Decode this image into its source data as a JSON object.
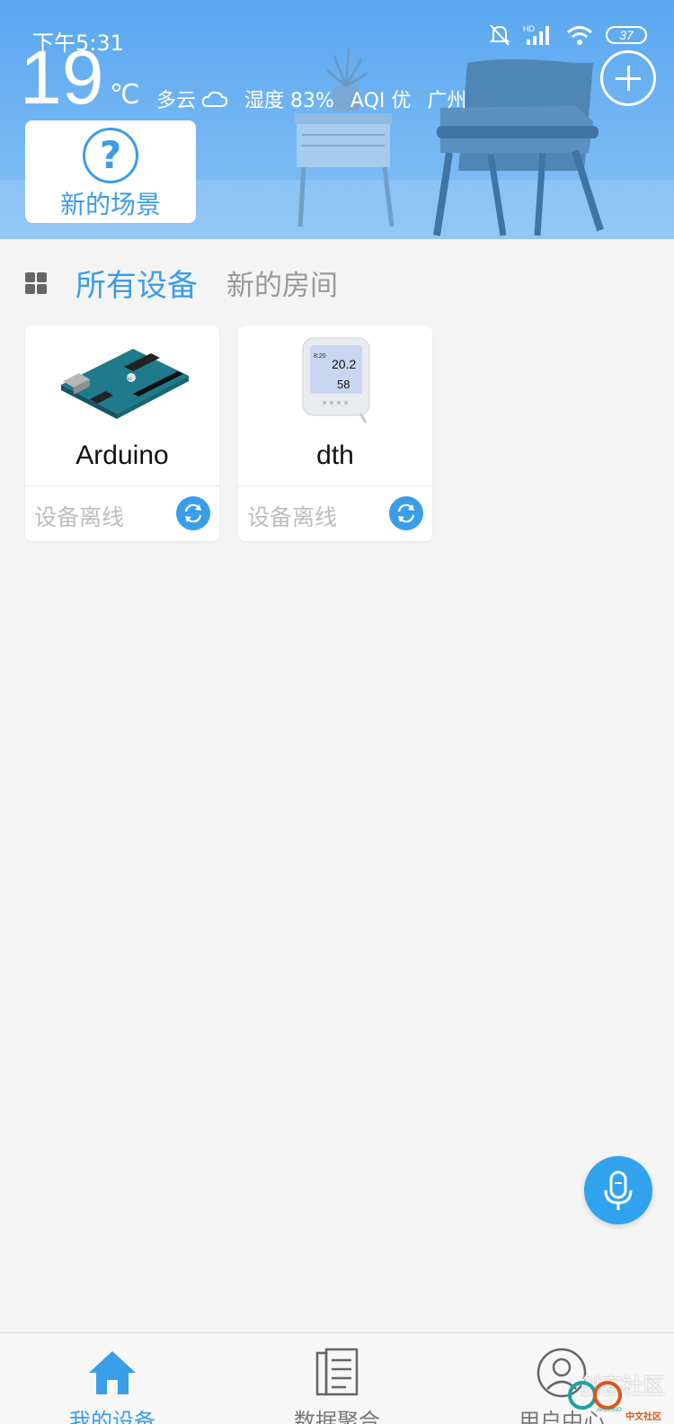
{
  "status_bar": {
    "time": "下午5:31",
    "battery": "37",
    "network_label": "HD"
  },
  "weather": {
    "temperature": "19",
    "unit": "℃",
    "condition": "多云",
    "condition_icon": "cloud-icon",
    "humidity": "湿度 83%",
    "aqi": "AQI 优",
    "city": "广州"
  },
  "scene_card": {
    "icon": "question-icon",
    "label": "新的场景"
  },
  "tabs": [
    {
      "label": "所有设备",
      "active": true
    },
    {
      "label": "新的房间",
      "active": false
    }
  ],
  "devices": [
    {
      "name": "Arduino",
      "status": "设备离线",
      "image": "arduino-board-image"
    },
    {
      "name": "dth",
      "status": "设备离线",
      "image": "thermometer-device-image"
    }
  ],
  "thermometer_display": {
    "time": "8:20",
    "temperature": "20.2",
    "humidity": "58"
  },
  "bottom_nav": [
    {
      "label": "我的设备",
      "icon": "home-icon",
      "active": true
    },
    {
      "label": "数据聚合",
      "icon": "document-icon",
      "active": false
    },
    {
      "label": "用户中心",
      "icon": "user-icon",
      "active": false
    }
  ],
  "watermark": {
    "text": "创客社区",
    "sub": "中文社区",
    "brand": "ARDUINO"
  },
  "colors": {
    "accent": "#3a9de9",
    "banner": "#5aa7f0",
    "background": "#f4f4f4"
  }
}
